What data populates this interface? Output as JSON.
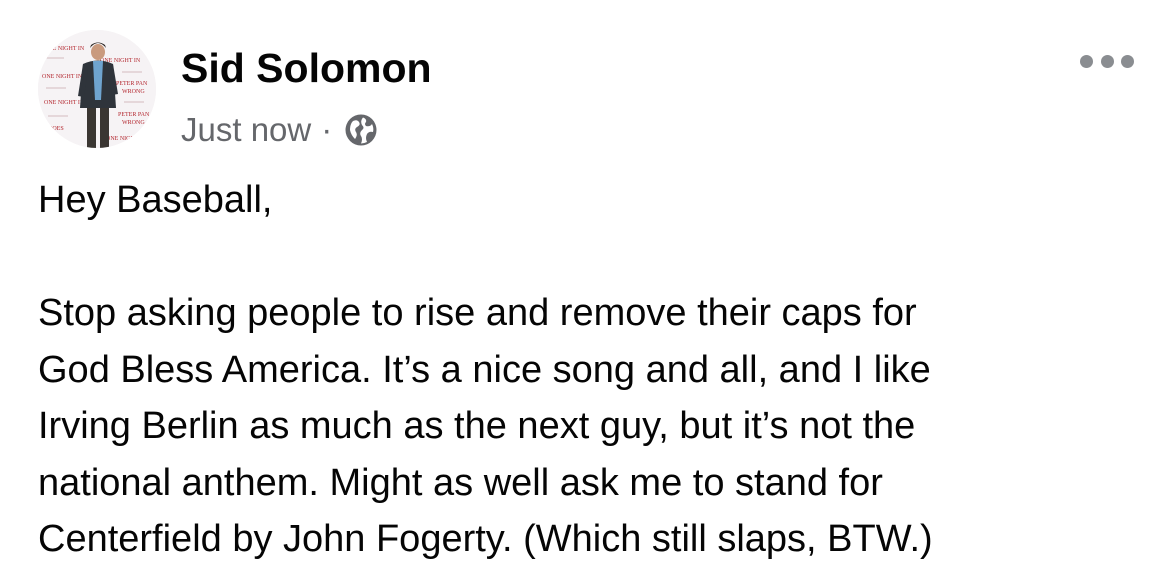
{
  "post": {
    "author": "Sid Solomon",
    "timestamp": "Just now",
    "separator": "·",
    "audience_icon": "globe-icon",
    "more_icon": "more-options-icon",
    "avatar_backdrop_text": [
      "ONE NIGHT IN",
      "PETER PAN",
      "WRONG",
      "GOES"
    ],
    "message": {
      "greeting": "Hey Baseball,",
      "lines": [
        "Stop asking people to rise and remove their caps for",
        "God Bless America. It’s a nice song and all, and I like",
        "Irving Berlin as much as the next guy, but it’s not the",
        "national anthem. Might as well ask me to stand for",
        "Centerfield by John Fogerty. (Which still slaps, BTW.)"
      ]
    }
  },
  "colors": {
    "text_primary": "#050505",
    "text_secondary": "#65676b",
    "icon_gray": "#8a8d91",
    "backdrop_red": "#b3262e"
  }
}
